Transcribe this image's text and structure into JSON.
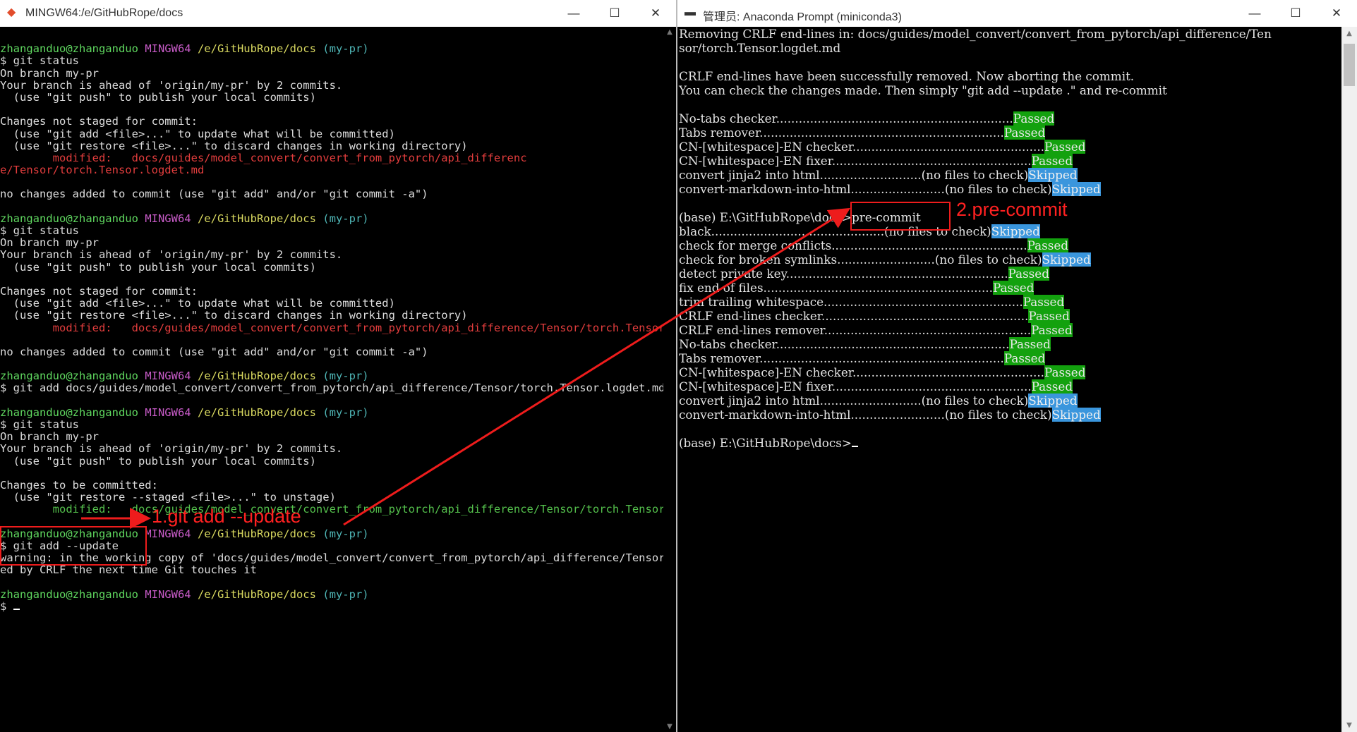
{
  "left_window": {
    "title": "MINGW64:/e/GitHubRope/docs",
    "icon": "git-bash-icon",
    "lines": [
      [],
      [
        {
          "t": "zhanganduo@zhanganduo ",
          "c": "u"
        },
        {
          "t": "MINGW64 ",
          "c": "m"
        },
        {
          "t": "/e/GitHubRope/docs ",
          "c": "p"
        },
        {
          "t": "(my-pr)",
          "c": "b"
        }
      ],
      [
        {
          "t": "$ git status"
        }
      ],
      [
        {
          "t": "On branch my-pr"
        }
      ],
      [
        {
          "t": "Your branch is ahead of 'origin/my-pr' by 2 commits."
        }
      ],
      [
        {
          "t": "  (use \"git push\" to publish your local commits)"
        }
      ],
      [],
      [
        {
          "t": "Changes not staged for commit:"
        }
      ],
      [
        {
          "t": "  (use \"git add <file>...\" to update what will be committed)"
        }
      ],
      [
        {
          "t": "  (use \"git restore <file>...\" to discard changes in working directory)"
        }
      ],
      [
        {
          "t": "        modified:   docs/guides/model_convert/convert_from_pytorch/api_differenc",
          "c": "r"
        }
      ],
      [
        {
          "t": "e/Tensor/torch.Tensor.logdet.md",
          "c": "r"
        }
      ],
      [],
      [
        {
          "t": "no changes added to commit (use \"git add\" and/or \"git commit -a\")"
        }
      ],
      [],
      [
        {
          "t": "zhanganduo@zhanganduo ",
          "c": "u"
        },
        {
          "t": "MINGW64 ",
          "c": "m"
        },
        {
          "t": "/e/GitHubRope/docs ",
          "c": "p"
        },
        {
          "t": "(my-pr)",
          "c": "b"
        }
      ],
      [
        {
          "t": "$ git status"
        }
      ],
      [
        {
          "t": "On branch my-pr"
        }
      ],
      [
        {
          "t": "Your branch is ahead of 'origin/my-pr' by 2 commits."
        }
      ],
      [
        {
          "t": "  (use \"git push\" to publish your local commits)"
        }
      ],
      [],
      [
        {
          "t": "Changes not staged for commit:"
        }
      ],
      [
        {
          "t": "  (use \"git add <file>...\" to update what will be committed)"
        }
      ],
      [
        {
          "t": "  (use \"git restore <file>...\" to discard changes in working directory)"
        }
      ],
      [
        {
          "t": "        modified:   docs/guides/model_convert/convert_from_pytorch/api_difference/Tensor/torch.Tensor.l",
          "c": "r"
        }
      ],
      [],
      [
        {
          "t": "no changes added to commit (use \"git add\" and/or \"git commit -a\")"
        }
      ],
      [],
      [
        {
          "t": "zhanganduo@zhanganduo ",
          "c": "u"
        },
        {
          "t": "MINGW64 ",
          "c": "m"
        },
        {
          "t": "/e/GitHubRope/docs ",
          "c": "p"
        },
        {
          "t": "(my-pr)",
          "c": "b"
        }
      ],
      [
        {
          "t": "$ git add docs/guides/model_convert/convert_from_pytorch/api_difference/Tensor/torch.Tensor.logdet.md"
        }
      ],
      [],
      [
        {
          "t": "zhanganduo@zhanganduo ",
          "c": "u"
        },
        {
          "t": "MINGW64 ",
          "c": "m"
        },
        {
          "t": "/e/GitHubRope/docs ",
          "c": "p"
        },
        {
          "t": "(my-pr)",
          "c": "b"
        }
      ],
      [
        {
          "t": "$ git status"
        }
      ],
      [
        {
          "t": "On branch my-pr"
        }
      ],
      [
        {
          "t": "Your branch is ahead of 'origin/my-pr' by 2 commits."
        }
      ],
      [
        {
          "t": "  (use \"git push\" to publish your local commits)"
        }
      ],
      [],
      [
        {
          "t": "Changes to be committed:"
        }
      ],
      [
        {
          "t": "  (use \"git restore --staged <file>...\" to unstage)"
        }
      ],
      [
        {
          "t": "        modified:   docs/guides/model_convert/convert_from_pytorch/api_difference/Tensor/torch.Tensor.l",
          "c": "g"
        }
      ],
      [],
      [
        {
          "t": "zhanganduo@zhanganduo ",
          "c": "u"
        },
        {
          "t": "MINGW64 ",
          "c": "m"
        },
        {
          "t": "/e/GitHubRope/docs ",
          "c": "p"
        },
        {
          "t": "(my-pr)",
          "c": "b"
        }
      ],
      [
        {
          "t": "$ git add --update"
        }
      ],
      [
        {
          "t": "warning: in the working copy of 'docs/guides/model_convert/convert_from_pytorch/api_difference/Tensor/t"
        }
      ],
      [
        {
          "t": "ed by CRLF the next time Git touches it"
        }
      ],
      [],
      [
        {
          "t": "zhanganduo@zhanganduo ",
          "c": "u"
        },
        {
          "t": "MINGW64 ",
          "c": "m"
        },
        {
          "t": "/e/GitHubRope/docs ",
          "c": "p"
        },
        {
          "t": "(my-pr)",
          "c": "b"
        }
      ],
      [
        {
          "t": "$ "
        }
      ]
    ]
  },
  "right_window": {
    "title": "管理员: Anaconda Prompt (miniconda3)",
    "icon": "console-icon",
    "lines": [
      [
        {
          "t": "Removing CRLF end-lines in: docs/guides/model_convert/convert_from_pytorch/api_difference/Ten"
        }
      ],
      [
        {
          "t": "sor/torch.Tensor.logdet.md"
        }
      ],
      [],
      [
        {
          "t": "CRLF end-lines have been successfully removed. Now aborting the commit."
        }
      ],
      [
        {
          "t": "You can check the changes made. Then simply \"git add --update .\" and re-commit"
        }
      ],
      [],
      [
        {
          "t": "No-tabs checker..............................................................."
        },
        {
          "t": "Passed",
          "c": "pass"
        }
      ],
      [
        {
          "t": "Tabs remover................................................................."
        },
        {
          "t": "Passed",
          "c": "pass"
        }
      ],
      [
        {
          "t": "CN-[whitespace]-EN checker..................................................."
        },
        {
          "t": "Passed",
          "c": "pass"
        }
      ],
      [
        {
          "t": "CN-[whitespace]-EN fixer....................................................."
        },
        {
          "t": "Passed",
          "c": "pass"
        }
      ],
      [
        {
          "t": "convert jinja2 into html...........................(no files to check)"
        },
        {
          "t": "Skipped",
          "c": "skip"
        }
      ],
      [
        {
          "t": "convert-markdown-into-html.........................(no files to check)"
        },
        {
          "t": "Skipped",
          "c": "skip"
        }
      ],
      [],
      [
        {
          "t": "(base) E:\\GitHubRope\\docs>pre-commit"
        }
      ],
      [
        {
          "t": "black..............................................(no files to check)"
        },
        {
          "t": "Skipped",
          "c": "skip"
        }
      ],
      [
        {
          "t": "check for merge conflicts...................................................."
        },
        {
          "t": "Passed",
          "c": "pass"
        }
      ],
      [
        {
          "t": "check for broken symlinks..........................(no files to check)"
        },
        {
          "t": "Skipped",
          "c": "skip"
        }
      ],
      [
        {
          "t": "detect private key..........................................................."
        },
        {
          "t": "Passed",
          "c": "pass"
        }
      ],
      [
        {
          "t": "fix end of files............................................................."
        },
        {
          "t": "Passed",
          "c": "pass"
        }
      ],
      [
        {
          "t": "trim trailing whitespace....................................................."
        },
        {
          "t": "Passed",
          "c": "pass"
        }
      ],
      [
        {
          "t": "CRLF end-lines checker......................................................."
        },
        {
          "t": "Passed",
          "c": "pass"
        }
      ],
      [
        {
          "t": "CRLF end-lines remover......................................................."
        },
        {
          "t": "Passed",
          "c": "pass"
        }
      ],
      [
        {
          "t": "No-tabs checker.............................................................."
        },
        {
          "t": "Passed",
          "c": "pass"
        }
      ],
      [
        {
          "t": "Tabs remover................................................................."
        },
        {
          "t": "Passed",
          "c": "pass"
        }
      ],
      [
        {
          "t": "CN-[whitespace]-EN checker..................................................."
        },
        {
          "t": "Passed",
          "c": "pass"
        }
      ],
      [
        {
          "t": "CN-[whitespace]-EN fixer....................................................."
        },
        {
          "t": "Passed",
          "c": "pass"
        }
      ],
      [
        {
          "t": "convert jinja2 into html...........................(no files to check)"
        },
        {
          "t": "Skipped",
          "c": "skip"
        }
      ],
      [
        {
          "t": "convert-markdown-into-html.........................(no files to check)"
        },
        {
          "t": "Skipped",
          "c": "skip"
        }
      ],
      [],
      [
        {
          "t": "(base) E:\\GitHubRope\\docs>"
        }
      ]
    ]
  },
  "annotations": {
    "step1": "1.git add --update",
    "step2": "2.pre-commit",
    "color": "#ee1c1c"
  },
  "window_controls": {
    "minimize": "—",
    "maximize": "☐",
    "close": "✕"
  },
  "colors": {
    "passed_bg": "#13a10e",
    "skipped_bg": "#3a96dd",
    "terminal_bg": "#000000"
  }
}
